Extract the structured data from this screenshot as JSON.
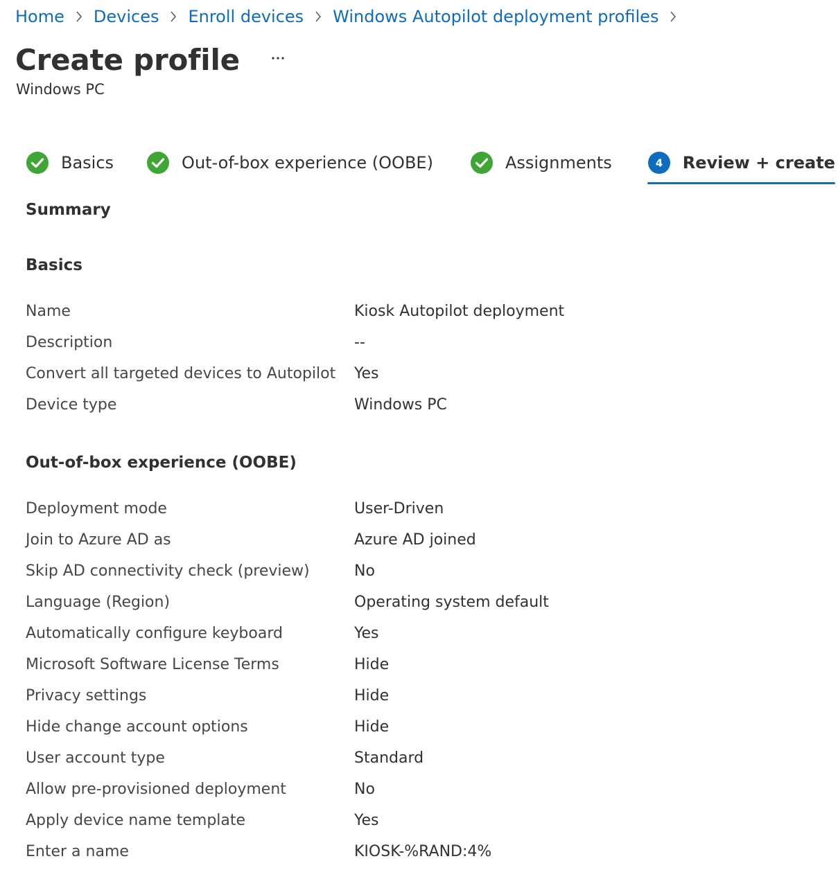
{
  "breadcrumb": [
    {
      "label": "Home"
    },
    {
      "label": "Devices"
    },
    {
      "label": "Enroll devices"
    },
    {
      "label": "Windows Autopilot deployment profiles"
    }
  ],
  "header": {
    "title": "Create profile",
    "more_label": "···",
    "subtitle": "Windows PC"
  },
  "steps": [
    {
      "label": "Basics",
      "status": "complete",
      "icon": "check-circle-icon"
    },
    {
      "label": "Out-of-box experience (OOBE)",
      "status": "complete",
      "icon": "check-circle-icon"
    },
    {
      "label": "Assignments",
      "status": "complete",
      "icon": "check-circle-icon"
    },
    {
      "label": "Review + create",
      "status": "active",
      "number": "4",
      "icon": "step-number-icon"
    }
  ],
  "summary": {
    "heading": "Summary",
    "sections": [
      {
        "heading": "Basics",
        "rows": [
          {
            "label": "Name",
            "value": "Kiosk Autopilot deployment"
          },
          {
            "label": "Description",
            "value": "--"
          },
          {
            "label": "Convert all targeted devices to Autopilot",
            "value": "Yes"
          },
          {
            "label": "Device type",
            "value": "Windows PC"
          }
        ]
      },
      {
        "heading": "Out-of-box experience (OOBE)",
        "rows": [
          {
            "label": "Deployment mode",
            "value": "User-Driven"
          },
          {
            "label": "Join to Azure AD as",
            "value": "Azure AD joined"
          },
          {
            "label": "Skip AD connectivity check (preview)",
            "value": "No"
          },
          {
            "label": "Language (Region)",
            "value": "Operating system default"
          },
          {
            "label": "Automatically configure keyboard",
            "value": "Yes"
          },
          {
            "label": "Microsoft Software License Terms",
            "value": "Hide"
          },
          {
            "label": "Privacy settings",
            "value": "Hide"
          },
          {
            "label": "Hide change account options",
            "value": "Hide"
          },
          {
            "label": "User account type",
            "value": "Standard"
          },
          {
            "label": "Allow pre-provisioned deployment",
            "value": "No"
          },
          {
            "label": "Apply device name template",
            "value": "Yes"
          },
          {
            "label": "Enter a name",
            "value": "KIOSK-%RAND:4%"
          }
        ]
      }
    ]
  },
  "colors": {
    "link": "#0f6cbd",
    "success": "#3fa535",
    "accent": "#0f6cbd",
    "text": "#323130"
  }
}
